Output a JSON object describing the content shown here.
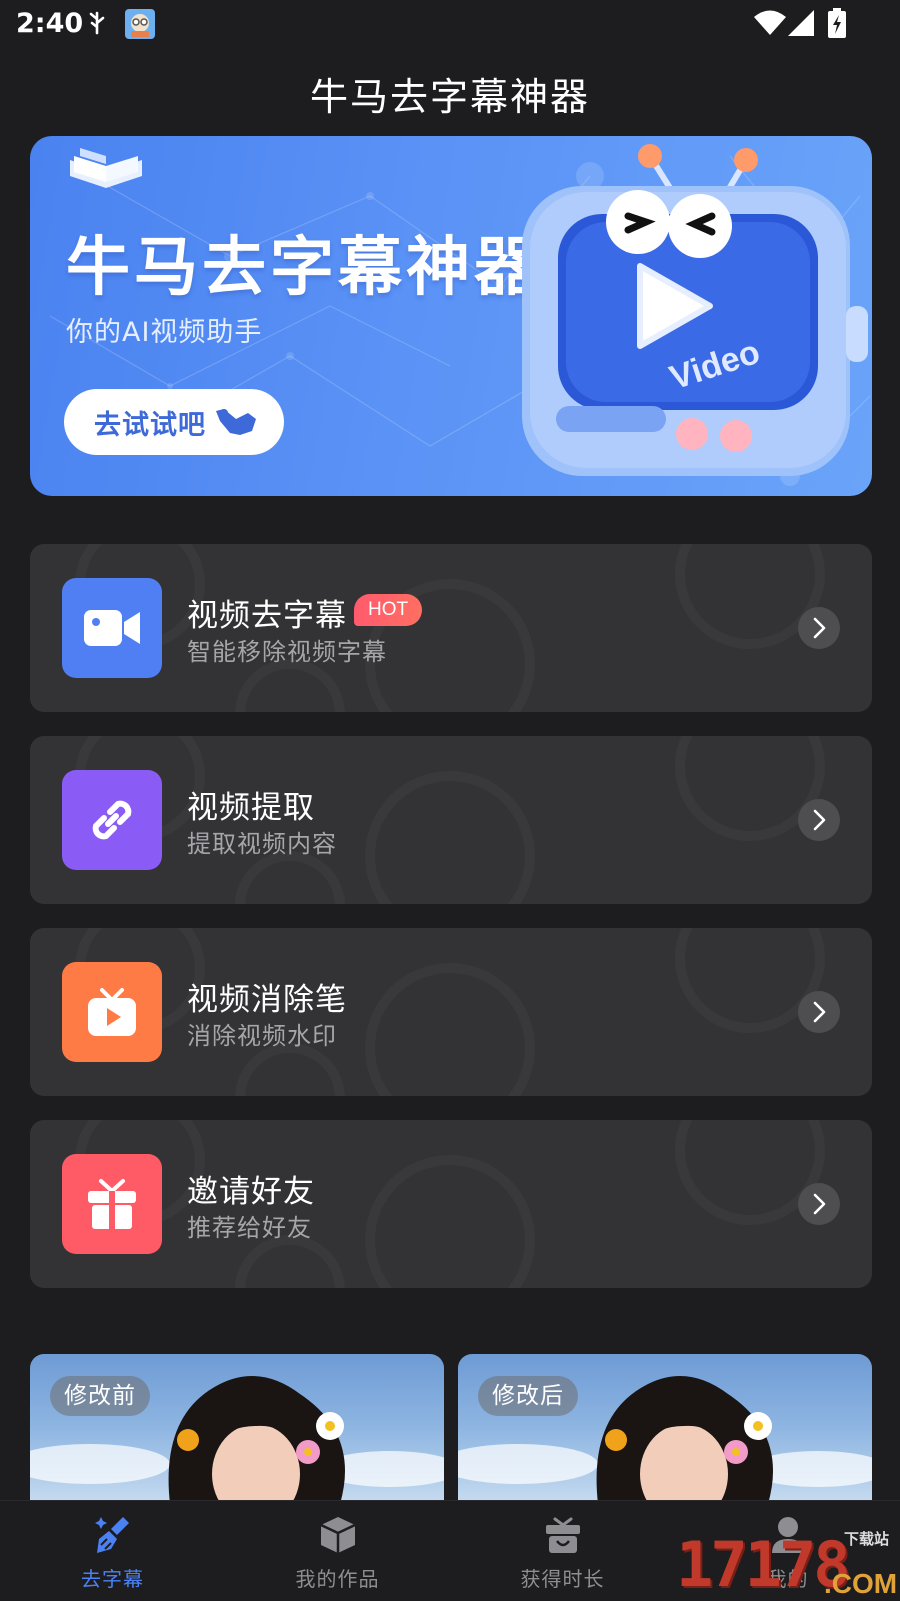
{
  "status_bar": {
    "time": "2:40"
  },
  "header": {
    "title": "牛马去字幕神器"
  },
  "banner": {
    "title": "牛马去字幕神器",
    "subtitle": "你的AI视频助手",
    "button_label": "去试试吧",
    "tv_label": "Video"
  },
  "features": [
    {
      "title": "视频去字幕",
      "subtitle": "智能移除视频字幕",
      "badge": "HOT",
      "icon": "video-camera-icon",
      "color": "#4f7ff2"
    },
    {
      "title": "视频提取",
      "subtitle": "提取视频内容",
      "icon": "link-icon",
      "color": "#8a5cf5"
    },
    {
      "title": "视频消除笔",
      "subtitle": "消除视频水印",
      "icon": "tv-icon",
      "color": "#ff7b45"
    },
    {
      "title": "邀请好友",
      "subtitle": "推荐给好友",
      "icon": "gift-icon",
      "color": "#ff5b67"
    }
  ],
  "compare": {
    "before_label": "修改前",
    "after_label": "修改后"
  },
  "bottom_nav": [
    {
      "label": "去字幕",
      "icon": "broom-icon",
      "active": true
    },
    {
      "label": "我的作品",
      "icon": "box-icon",
      "active": false
    },
    {
      "label": "获得时长",
      "icon": "gift-box-icon",
      "active": false
    },
    {
      "label": "我的",
      "icon": "user-icon",
      "active": false
    }
  ],
  "watermark": {
    "number": "17178",
    "download": "下载站",
    "domain": ".COM"
  },
  "colors": {
    "background": "#1d1d1f",
    "card": "#333335",
    "accent": "#4a82f6",
    "hot": "#ff5a6e"
  }
}
